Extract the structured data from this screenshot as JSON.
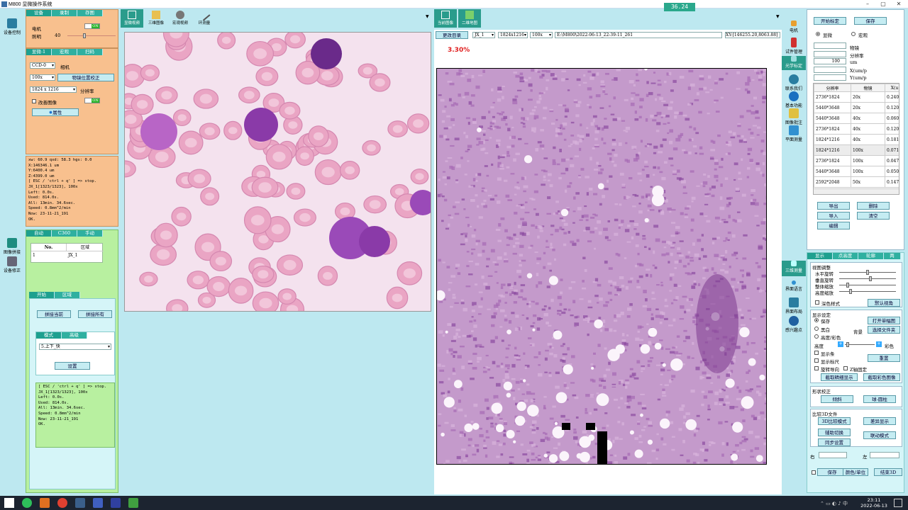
{
  "window": {
    "title": "M800 显微操作系统",
    "fps": "36.24"
  },
  "leftnav": {
    "items": [
      {
        "label": "设备控制"
      },
      {
        "label": "图像拼接"
      },
      {
        "label": "设备修正"
      }
    ]
  },
  "device_panel": {
    "tabs": [
      "设备",
      "录制",
      "存图"
    ],
    "motor_label": "电机",
    "motor_toggle": "ON",
    "light_label": "照明",
    "light_value": "40"
  },
  "camera_panel": {
    "tabs": [
      "显微-1",
      "宏观",
      "扫码"
    ],
    "camera_select": "CCD-0",
    "camera_label": "相机",
    "objective_select": "100x",
    "objective_btn": "物镜位置校正",
    "resolution_select": "1824 x 1216",
    "resolution_label": "分辨率",
    "improve_label": "改善图像",
    "improve_toggle": "ON",
    "props_btn": "属性"
  },
  "status_log": "xw: 60.9 qxd: 58.3 hgs: 0.0\nX:146346.1 um\nY:6400.4 um\nZ:4399.0 um\n[ ESC / 'ctrl + q' ] => stop.\nJX_1[1323/1323], 100x\nLeft: 0.0s.\nUsed: 814.0s.\nAll: 13min. 34.6sec.\nSpeed: 0.8mm^2/min\nNow: 23-11-21_191\nOK.",
  "stitch_panel": {
    "tabs": [
      "自动",
      "C360",
      "手动"
    ],
    "table_headers": [
      "No.",
      "区域"
    ],
    "table_rows": [
      [
        "1",
        "JX_1"
      ]
    ],
    "sub_tabs": [
      "开始",
      "区域"
    ],
    "stitch_current": "拼接当前",
    "stitch_all": "拼接所有",
    "mode_tabs": [
      "模式",
      "高级"
    ],
    "mode_select": "5.上下_快",
    "set_btn": "设置",
    "log": "[ ESC / 'ctrl + q' ] => stop.\nJX_1[1323/1323], 100x\nLeft: 0.0s.\nUsed: 814.0s.\nAll: 13min. 34.6sec.\nSpeed: 0.8mm^2/min\nNow: 23-11-21_191\nOK."
  },
  "view_toolbar": {
    "items": [
      "显微视频",
      "三维图像",
      "宏观视频",
      "环测量"
    ]
  },
  "right_toolbar": {
    "items": [
      "当前图像",
      "二维地图"
    ]
  },
  "image_bar": {
    "change_dir_btn": "更改目录",
    "region_select": "JX_1",
    "res_select": "1824x1216",
    "mag_select": "100x",
    "path": "E:\\M800\\2022-06-13_22-39-11_261",
    "coords": "XY:[146255.20,8063.88]"
  },
  "percent": "3.30%",
  "rightnav": {
    "items": [
      "电机",
      "试件管理",
      "光学标定",
      "联系我们",
      "基本功能",
      "图像批注",
      "平面测量"
    ]
  },
  "calib_panel": {
    "start_btn": "开始标定",
    "save_btn": "保存",
    "radio_micro": "显微",
    "radio_macro": "宏观",
    "objective_label": "物镜",
    "resolution_label": "分辨率",
    "um_value": "100",
    "um_label": "um",
    "x_label": "X(um/p",
    "y_label": "Y(um/p",
    "headers": [
      "分辨率",
      "物镜",
      "X(u"
    ],
    "rows": [
      [
        "2736*1824",
        "20x",
        "0.240"
      ],
      [
        "5440*3648",
        "20x",
        "0.120"
      ],
      [
        "5440*3648",
        "40x",
        "0.060"
      ],
      [
        "2736*1824",
        "40x",
        "0.120"
      ],
      [
        "1824*1216",
        "40x",
        "0.181"
      ],
      [
        "1824*1216",
        "100x",
        "0.071"
      ],
      [
        "2736*1824",
        "100x",
        "0.047"
      ],
      [
        "5440*3648",
        "100x",
        "0.050"
      ],
      [
        "2592*2048",
        "50x",
        "0.147"
      ]
    ],
    "export_btn": "导出",
    "delete_btn": "删除",
    "import_btn": "导入",
    "clear_btn": "清空",
    "edit_btn": "编辑"
  },
  "leftnav2": {
    "items": [
      "三维测量",
      "界面语言",
      "界面布局",
      "感兴趣点"
    ]
  },
  "display_panel": {
    "tabs": [
      "显示",
      "点高度",
      "轮廓",
      "两"
    ],
    "view_adjust_title": "视图调整",
    "slider_labels": [
      "水平旋转",
      "垂直旋转",
      "整体缩放",
      "高度缩放"
    ],
    "dark_label": "深色样式",
    "default_view_btn": "默认视角",
    "display_title": "显示设定",
    "radio_labels": [
      "保存",
      "黑白",
      "高度/彩色"
    ],
    "open_single_btn": "打开单幅图",
    "bg_label": "背景",
    "select_file_btn": "选择文件夹",
    "height_label": "高度",
    "color_label": "彩色",
    "check_labels": [
      "显示条",
      "显示标尺",
      "旋转导向"
    ],
    "zfix_label": "Z轴固定",
    "reset_btn": "重置",
    "crop_bw_btn": "截取精细显示",
    "crop_color_btn": "截取彩色图像",
    "shape_title": "形状校正",
    "flip_btn": "倾斜",
    "ball_btn": "球-圆柱",
    "compare_title": "比较3D文件",
    "compare_mode_btn": "3D比较模式",
    "diff_btn": "差异显示",
    "assist_btn": "辅助切换",
    "link_btn": "联动模式",
    "sync_btn": "同步设置",
    "right_label": "右",
    "left_label": "左",
    "save_btn": "保存",
    "unit_btn": "颜色/单位",
    "end_btn": "结束3D"
  },
  "clock": {
    "time": "23:11",
    "date": "2022-06-13"
  },
  "colors": {
    "teal": "#2fb0a0",
    "orange_panel": "#f8c08e",
    "green_panel": "#b8f0a0",
    "bg": "#bde8f0"
  }
}
